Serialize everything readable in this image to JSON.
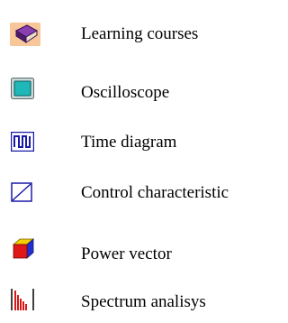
{
  "menu": {
    "items": [
      {
        "label": "Learning courses",
        "icon": "book-icon"
      },
      {
        "label": "Oscilloscope",
        "icon": "oscilloscope-icon"
      },
      {
        "label": "Time diagram",
        "icon": "time-diagram-icon"
      },
      {
        "label": "Control characteristic",
        "icon": "control-characteristic-icon"
      },
      {
        "label": "Power vector",
        "icon": "power-vector-icon"
      },
      {
        "label": "Spectrum analisys",
        "icon": "spectrum-icon"
      }
    ]
  },
  "colors": {
    "book_purple": "#6a2a8a",
    "icon_bg_orange": "#f7c79a",
    "teal": "#1fb8b8",
    "blue": "#1a1aa8",
    "cube_red": "#e01818",
    "cube_yellow": "#f4d000",
    "cube_blue": "#2030d0",
    "spectrum_red": "#d81818"
  }
}
